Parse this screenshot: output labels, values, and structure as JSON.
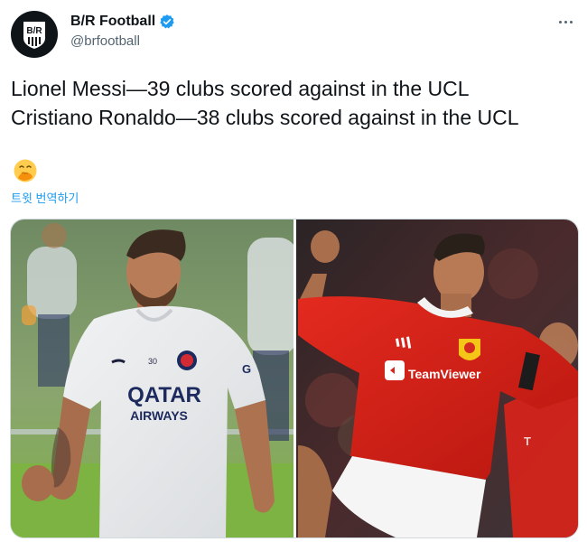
{
  "author": {
    "display_name": "B/R Football",
    "handle": "@brfootball",
    "avatar_text": "B/R",
    "verified": true
  },
  "tweet": {
    "lines": [
      "Lionel Messi—39 clubs scored against in the UCL",
      "Cristiano Ronaldo—38 clubs scored against in the UCL"
    ],
    "emoji": "face-with-hand-over-mouth",
    "translate_label": "트윗 번역하기"
  },
  "media": {
    "left_photo": {
      "shirt_sponsor_top": "QATAR",
      "shirt_sponsor_bottom": "AIRWAYS",
      "shirt_number": "30"
    },
    "right_photo": {
      "shirt_sponsor": "TeamViewer"
    }
  },
  "colors": {
    "accent": "#1d9bf0",
    "text": "#0f1419",
    "secondary_text": "#536471",
    "united_red": "#d9261c"
  }
}
